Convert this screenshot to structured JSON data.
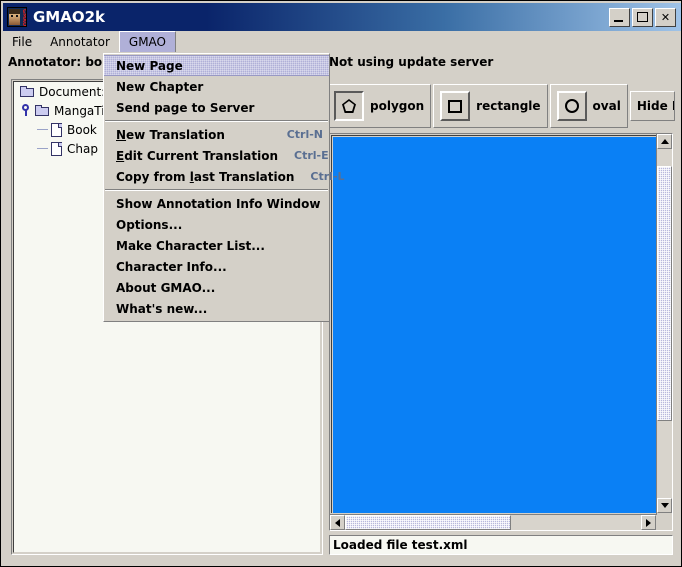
{
  "window": {
    "title": "GMAO2k",
    "icon": "gmao-app-icon",
    "controls": {
      "minimize": "minimize-button",
      "maximize": "maximize-button",
      "close_label": "✕"
    },
    "titlebar_gradient_start": "#0a246a",
    "titlebar_gradient_end": "#9fc3e8"
  },
  "menubar": {
    "items": [
      {
        "label": "File",
        "active": false
      },
      {
        "label": "Annotator",
        "active": false
      },
      {
        "label": "GMAO",
        "active": true
      }
    ]
  },
  "status_strip": {
    "annotator": "Annotator: bobo (b",
    "update_server": "Not using update server"
  },
  "dropdown": {
    "open_for": "GMAO",
    "groups": [
      {
        "items": [
          {
            "label": "New Page",
            "accel": "",
            "selected": true
          },
          {
            "label": "New Chapter",
            "accel": "",
            "selected": false
          },
          {
            "label": "Send page to Server",
            "accel": "",
            "selected": false
          }
        ]
      },
      {
        "items": [
          {
            "label": "New Translation",
            "accel": "Ctrl-N",
            "selected": false,
            "mnemonic": "N"
          },
          {
            "label": "Edit Current Translation",
            "accel": "Ctrl-E",
            "selected": false,
            "mnemonic": "E"
          },
          {
            "label": "Copy from last Translation",
            "accel": "Ctrl-L",
            "selected": false,
            "mnemonic": "l"
          }
        ]
      },
      {
        "items": [
          {
            "label": "Show Annotation Info Window",
            "accel": "",
            "selected": false
          },
          {
            "label": "Options...",
            "accel": "",
            "selected": false
          },
          {
            "label": "Make Character List...",
            "accel": "",
            "selected": false
          },
          {
            "label": "Character Info...",
            "accel": "",
            "selected": false
          },
          {
            "label": "About GMAO...",
            "accel": "",
            "selected": false
          },
          {
            "label": "What's new...",
            "accel": "",
            "selected": false
          }
        ]
      }
    ]
  },
  "tree": {
    "rows": [
      {
        "icon": "folder-icon",
        "label": "Document:",
        "indent": 1,
        "handle": false
      },
      {
        "icon": "folder-icon",
        "label": "MangaTi",
        "indent": 1,
        "handle": true
      },
      {
        "icon": "file-icon",
        "label": "Book",
        "indent": 3,
        "handle": false,
        "elbow": true
      },
      {
        "icon": "file-icon",
        "label": "Chap",
        "indent": 3,
        "handle": false,
        "elbow": true
      }
    ]
  },
  "toolbar": {
    "groups": [
      {
        "button": {
          "name": "polygon-tool",
          "icon": "polygon-icon",
          "pressed": true
        },
        "label": "polygon"
      },
      {
        "button": {
          "name": "rectangle-tool",
          "icon": "rectangle-icon",
          "pressed": false
        },
        "label": "rectangle"
      },
      {
        "button": {
          "name": "oval-tool",
          "icon": "oval-icon",
          "pressed": false
        },
        "label": "oval"
      }
    ],
    "hide_bubbles_label": "Hide Bubbl"
  },
  "canvas": {
    "fill_color": "#0a80f5",
    "vertical_scrollbar": {
      "thumb_top_pct": 5,
      "thumb_height_pct": 73
    },
    "horizontal_scrollbar": {
      "thumb_left_pct": 0,
      "thumb_width_pct": 56
    }
  },
  "statusbar": {
    "message": "Loaded file test.xml"
  }
}
